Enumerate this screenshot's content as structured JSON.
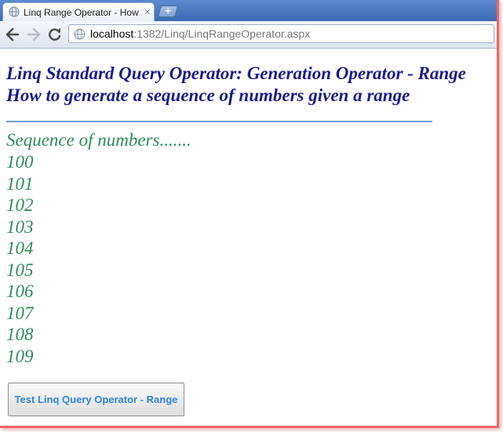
{
  "browser": {
    "tab": {
      "title": "Linq Range Operator - How",
      "close_glyph": "×",
      "favicon": "globe-icon"
    },
    "new_tab_glyph": "+",
    "address": {
      "host": "localhost",
      "path": ":1382/Linq/LinqRangeOperator.aspx",
      "icon": "globe-icon"
    }
  },
  "page": {
    "heading_line1": "Linq Standard Query Operator: Generation Operator - Range",
    "heading_line2": "How to generate a sequence of numbers given a range",
    "sequence_caption": "Sequence of numbers.......",
    "numbers": [
      "100",
      "101",
      "102",
      "103",
      "104",
      "105",
      "106",
      "107",
      "108",
      "109"
    ],
    "button_label": "Test Linq Query Operator - Range"
  },
  "colors": {
    "heading": "#1a1a8c",
    "numbers": "#2e8b57",
    "button_text": "#2f86d9",
    "rule": "#6f9bd8"
  }
}
